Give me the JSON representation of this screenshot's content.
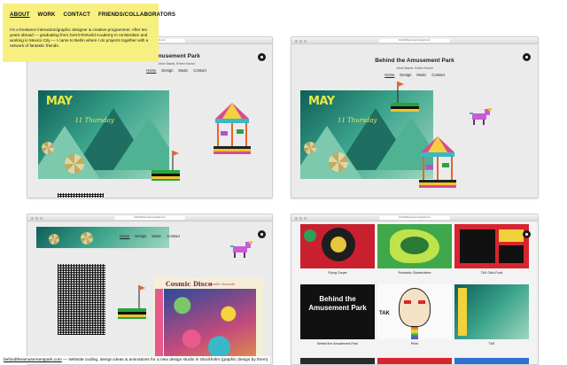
{
  "about": {
    "nav": [
      "ABOUT",
      "WORK",
      "CONTACT",
      "FRIENDS/COLLABORATORS"
    ],
    "bio": "I'm a freelance interaction/graphic designer & creative programmer. After ten years abroad — graduating from Gerrit Rietveld Academy in Amsterdam and working in Mexico City — I came to Berlin where I do projects together with a network of fantastic friends."
  },
  "site": {
    "url": "behindtheamusementpark.com",
    "title_short": "Amusement Park",
    "title": "Behind the Amusement Park",
    "authors": "Johan Basels, Helene Haurvs",
    "nav": [
      "Home",
      "Design",
      "Music",
      "Contact"
    ],
    "active_nav": "Home"
  },
  "poster": {
    "headline": "MAY",
    "subhead": "11 Thursday"
  },
  "thumbs": [
    {
      "label": "Flying Carpet"
    },
    {
      "label": "Romantic Globetrotters"
    },
    {
      "label": "TAK Odin-Funk"
    },
    {
      "label": "Behind the Amusement Park",
      "text": "Behind the Amusement Park"
    },
    {
      "label": "Pride",
      "text": "TAK"
    },
    {
      "label": "TAK"
    }
  ],
  "cosmic": {
    "title": "Cosmic Disco",
    "side": "Border Sounds"
  },
  "caption": {
    "link": "behindtheamusementpark.com",
    "text": " — Website coding, design ideas & animations for a new design studio in Stockholm (graphic design by them)"
  },
  "colors": {
    "note_yellow": "#f7f080",
    "poster_teal": "#2f8e7a",
    "flag_orange": "#e8642a",
    "frame_gray": "#ececec"
  }
}
